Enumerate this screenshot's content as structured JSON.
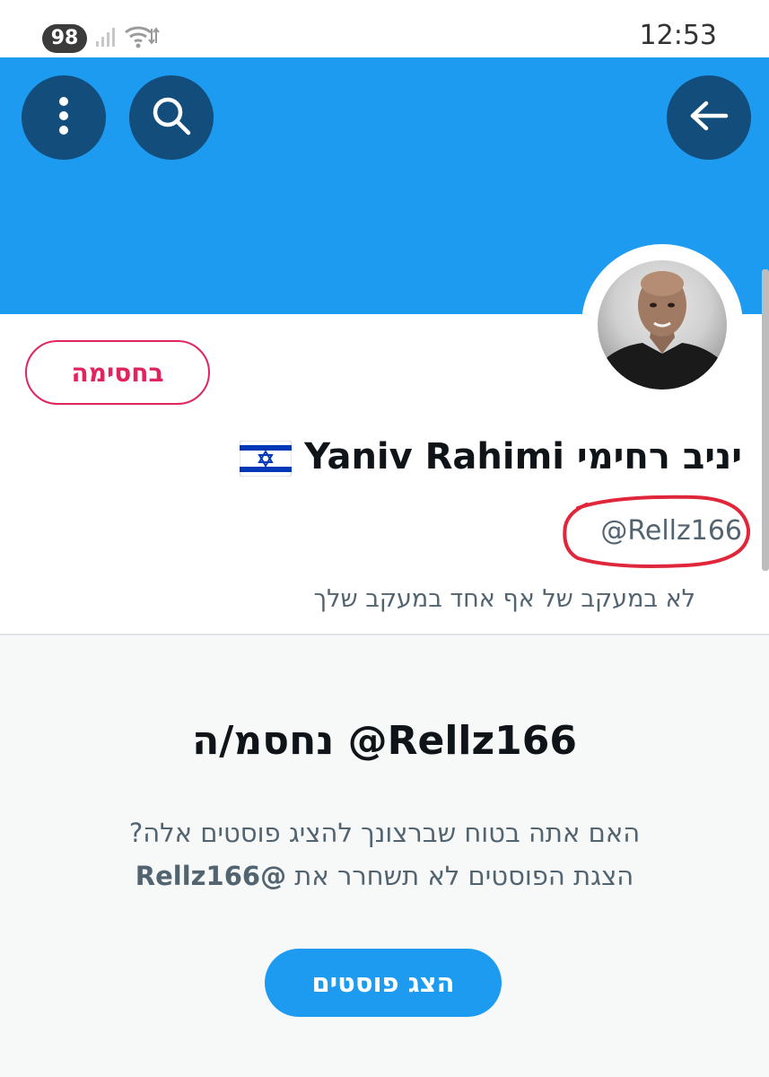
{
  "status_bar": {
    "battery": "98",
    "clock": "12:53",
    "network_icons": [
      "signal-icon",
      "wifi-icon"
    ]
  },
  "header": {
    "buttons": [
      "more-icon",
      "search-icon",
      "back-arrow-icon"
    ],
    "banner_color": "#1d9bf0",
    "button_color": "#134d7b"
  },
  "profile": {
    "blocked_label": "בחסימה",
    "display_name": "יניב רחימי Yaniv Rahimi",
    "flag_icon": "israel-flag-icon",
    "handle": "@Rellz166",
    "follow_status": "לא במעקב של אף אחד במעקב שלך",
    "accent_color": "#e0245e"
  },
  "blocked_notice": {
    "title": "‎@Rellz166 נחסמ/ה",
    "line1": "האם אתה בטוח שברצונך להציג פוסטים אלה?",
    "line2_prefix": "הצגת הפוסטים לא תשחרר את",
    "line2_handle": "@Rellz166",
    "show_posts_label": "הצג פוסטים"
  }
}
